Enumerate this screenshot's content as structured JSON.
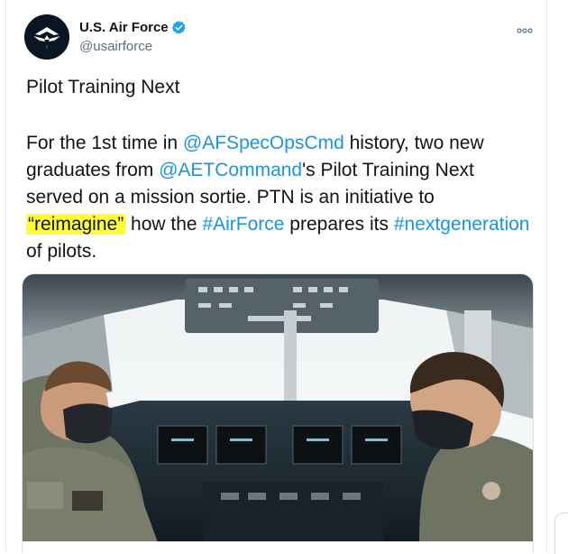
{
  "tweet": {
    "author": {
      "display_name": "U.S. Air Force",
      "handle": "@usairforce",
      "verified": true,
      "avatar_icon": "air-force-wings-logo-icon"
    },
    "menu_icon": "more-options-icon",
    "title": "Pilot Training Next",
    "body_segments": [
      {
        "type": "text",
        "value": "For the 1st time in "
      },
      {
        "type": "mention",
        "value": "@AFSpecOpsCmd"
      },
      {
        "type": "text",
        "value": " history, two new graduates from "
      },
      {
        "type": "mention",
        "value": "@AETCommand"
      },
      {
        "type": "text",
        "value": "'s Pilot Training Next served on a mission sortie. PTN is an initiative to "
      },
      {
        "type": "highlight",
        "value": "“reimagine”"
      },
      {
        "type": "text",
        "value": " how the "
      },
      {
        "type": "hashtag",
        "value": "#AirForce"
      },
      {
        "type": "text",
        "value": " prepares its "
      },
      {
        "type": "hashtag",
        "value": "#nextgeneration"
      },
      {
        "type": "text",
        "value": " of pilots."
      }
    ],
    "media": {
      "kind": "photo",
      "subject": "two-pilots-in-cockpit"
    }
  },
  "colors": {
    "link": "#1b95e0",
    "highlight": "#ffff33",
    "verified": "#1da1f2",
    "secondary_text": "#5b7083"
  }
}
